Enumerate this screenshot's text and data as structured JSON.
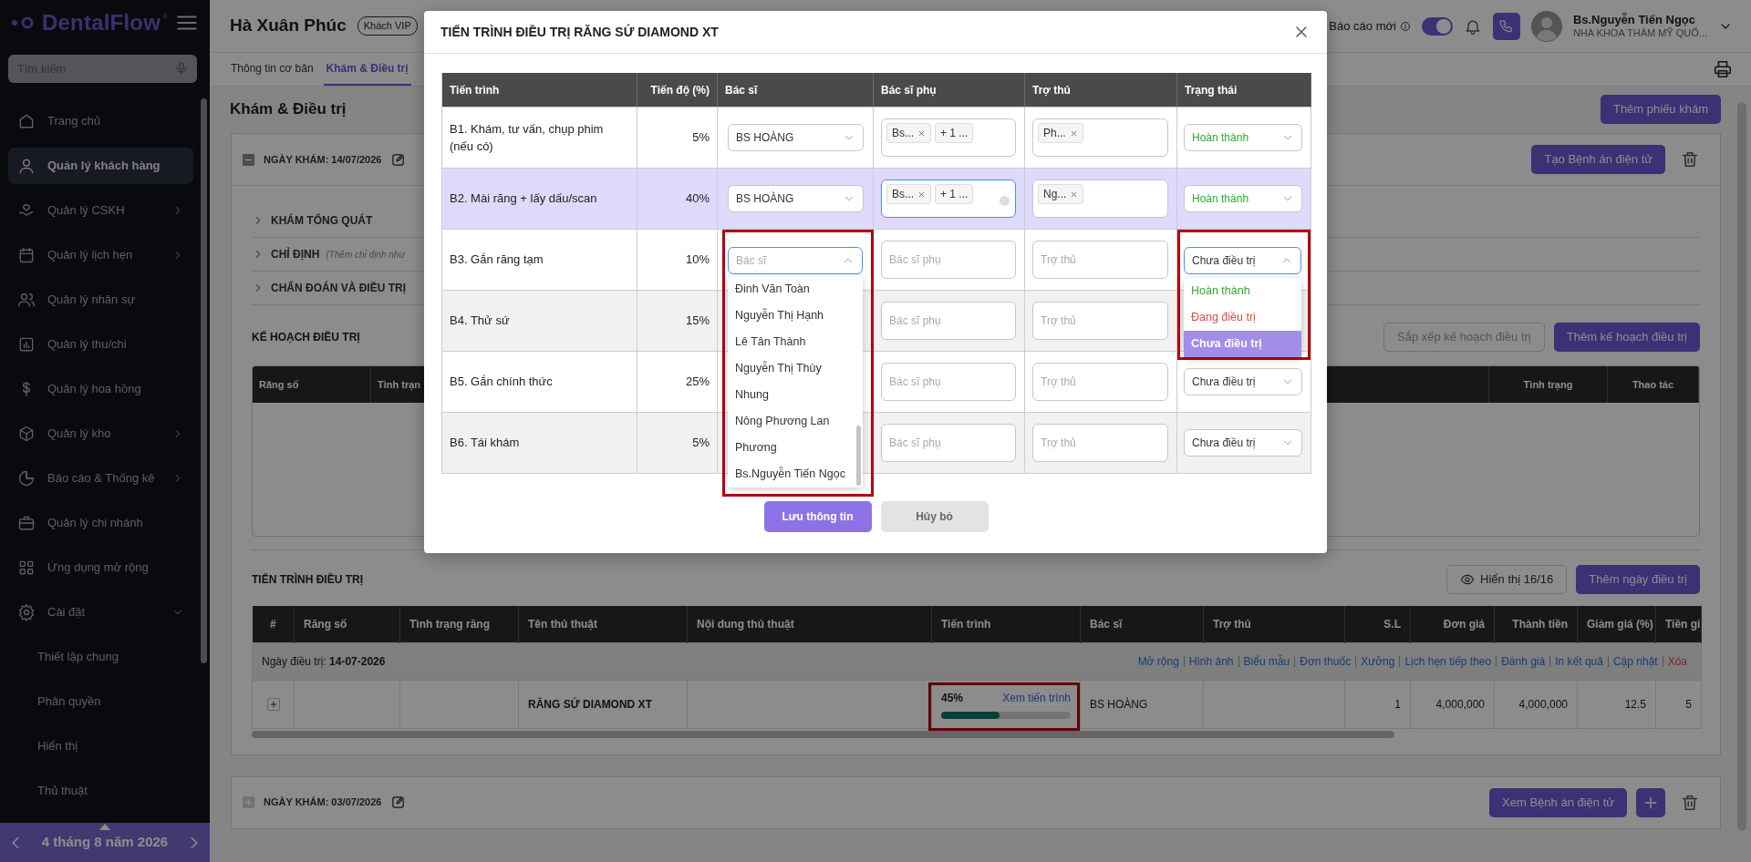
{
  "sidebar": {
    "logo": {
      "text": "DentalFlow",
      "mark": "®"
    },
    "search": {
      "placeholder": "Tìm kiếm"
    },
    "items": [
      {
        "label": "Trang chủ",
        "selected": false,
        "submenu": false
      },
      {
        "label": "Quản lý khách hàng",
        "selected": true,
        "submenu": false
      },
      {
        "label": "Quản lý CSKH",
        "selected": false,
        "submenu": true
      },
      {
        "label": "Quản lý lịch hẹn",
        "selected": false,
        "submenu": true
      },
      {
        "label": "Quản lý nhân sự",
        "selected": false,
        "submenu": false
      },
      {
        "label": "Quản lý thu/chi",
        "selected": false,
        "submenu": false
      },
      {
        "label": "Quản lý hoa hồng",
        "selected": false,
        "submenu": false
      },
      {
        "label": "Quản lý kho",
        "selected": false,
        "submenu": true
      },
      {
        "label": "Báo cáo & Thống kê",
        "selected": false,
        "submenu": true
      },
      {
        "label": "Quản lý chi nhánh",
        "selected": false,
        "submenu": false
      },
      {
        "label": "Ứng dụng mở rộng",
        "selected": false,
        "submenu": false
      },
      {
        "label": "Cài đặt",
        "selected": false,
        "submenu": true,
        "expanded": true,
        "children": [
          {
            "label": "Thiết lập chung"
          },
          {
            "label": "Phân quyền"
          },
          {
            "label": "Hiển thị"
          },
          {
            "label": "Thủ thuật"
          }
        ]
      }
    ],
    "date_bar": {
      "label": "4 tháng 8 năm 2026"
    }
  },
  "header": {
    "patient_name": "Hà Xuân Phúc",
    "badge": "Khách VIP",
    "report": {
      "label": "Báo cáo mới",
      "on": true
    },
    "user": {
      "name": "Bs.Nguyễn Tiến Ngọc",
      "clinic": "NHA KHOA THẨM MỸ QUỐ..."
    }
  },
  "tabs": [
    {
      "label": "Thông tin cơ bản",
      "selected": false
    },
    {
      "label": "Khám & Điều trị",
      "selected": true
    }
  ],
  "page": {
    "title": "Khám & Điều trị",
    "add_button": "Thêm phiếu khám"
  },
  "visits": [
    {
      "date": "NGÀY KHÁM: 14/07/2026",
      "expanded": true,
      "record_button": "Tạo Bệnh án điện tử",
      "sections": [
        {
          "title": "KHÁM TỔNG QUÁT"
        },
        {
          "title": "CHỈ ĐỊNH",
          "note": "(Thêm chỉ định như"
        },
        {
          "title": "CHẨN ĐOÁN VÀ ĐIỀU TRỊ"
        }
      ],
      "plan": {
        "title": "KẾ HOẠCH ĐIỀU TRỊ",
        "buttons": [
          {
            "label": "Sắp xếp kế hoạch điều trị",
            "kind": "outline"
          },
          {
            "label": "Thêm kế hoạch điều trị",
            "kind": "primary"
          }
        ],
        "columns": [
          "Răng số",
          "Tình trạn",
          "Tình trạng",
          "Thao tác"
        ]
      },
      "progress": {
        "title": "TIẾN TRÌNH ĐIỀU TRỊ",
        "show_button": "Hiển thị 16/16",
        "add_button": "Thêm ngày điều trị",
        "columns": [
          "#",
          "Răng số",
          "Tình trạng răng",
          "Tên thủ thuật",
          "Nội dung thủ thuật",
          "Tiến trình",
          "Bác sĩ",
          "Trợ thủ",
          "S.L",
          "Đơn giá",
          "Thành tiền",
          "Giảm giá (%)",
          "Tiền gi"
        ],
        "groups": [
          {
            "label": "Ngày điều trị: **14-07-2026**",
            "actions": [
              {
                "label": "Mở rộng",
                "kind": "link"
              },
              {
                "label": "Hình ảnh",
                "kind": "link"
              },
              {
                "label": "Biểu mẫu",
                "kind": "link"
              },
              {
                "label": "Đơn thuốc",
                "kind": "link"
              },
              {
                "label": "Xưởng",
                "kind": "link"
              },
              {
                "label": "Lịch hẹn tiếp theo",
                "kind": "link"
              },
              {
                "label": "Đánh giá",
                "kind": "link"
              },
              {
                "label": "In kết quả",
                "kind": "link"
              },
              {
                "label": "Cập nhật",
                "kind": "link"
              },
              {
                "label": "Xóa",
                "kind": "danger"
              }
            ],
            "rows": [
              {
                "procedure": "RĂNG SỨ DIAMOND XT",
                "progress": {
                  "reading": "45%",
                  "level": 0.45,
                  "link": "Xem tiến trình",
                  "highlighted": true
                },
                "doctor": "BS HOÀNG",
                "quantity": "1",
                "unit_price": "4,000,000",
                "total": "4,000,000",
                "discount": "12.5",
                "column_13": "5"
              }
            ]
          }
        ]
      }
    },
    {
      "date": "NGÀY KHÁM: 03/07/2026",
      "expanded": false,
      "record_button": "Xem Bệnh án điện tử"
    }
  ],
  "modal": {
    "title": "TIẾN TRÌNH ĐIỀU TRỊ RĂNG SỨ DIAMOND XT",
    "columns": [
      "Tiến trình",
      "Tiến độ (%)",
      "Bác sĩ",
      "Bác sĩ phụ",
      "Trợ thủ",
      "Trạng thái"
    ],
    "rows": [
      {
        "step": "B1. Khám, tư vấn, chụp phim (nếu có)",
        "percent": "5%",
        "selected": false,
        "doctor": {
          "value": "BS HOÀNG",
          "open": false,
          "highlighted": false
        },
        "assistants": {
          "tags": [
            {
              "text": "Bs...",
              "removable": true
            },
            {
              "text": "+ 1 ...",
              "removable": false
            }
          ],
          "focused": false
        },
        "helper": {
          "tags": [
            {
              "text": "Ph...",
              "removable": true
            }
          ],
          "focused": false
        },
        "status": {
          "value": "Hoàn thành",
          "color": "#2eaa2e",
          "open": false,
          "highlighted": false
        }
      },
      {
        "step": "B2. Mài răng + lấy dấu/scan",
        "percent": "40%",
        "selected": true,
        "doctor": {
          "value": "BS HOÀNG",
          "open": false,
          "highlighted": false
        },
        "assistants": {
          "tags": [
            {
              "text": "Bs...",
              "removable": true
            },
            {
              "text": "+ 1 ...",
              "removable": false
            }
          ],
          "focused": true
        },
        "helper": {
          "tags": [
            {
              "text": "Ng...",
              "removable": true
            }
          ],
          "focused": false
        },
        "status": {
          "value": "Hoàn thành",
          "color": "#2eaa2e",
          "open": false,
          "highlighted": false
        }
      },
      {
        "step": "B3. Gắn răng tạm",
        "percent": "10%",
        "selected": false,
        "doctor": {
          "placeholder": "Bác sĩ",
          "open": true,
          "highlighted": true,
          "options": [
            "Đinh Văn Toàn",
            "Nguyễn Thị Hạnh",
            "Lê Tân Thành",
            "Nguyễn Thị Thùy",
            "Nhung",
            "Nông Phương Lan",
            "Phương",
            "Bs.Nguyễn Tiến Ngọc"
          ]
        },
        "assistants": {
          "placeholder": "Bác sĩ phụ",
          "focused": false
        },
        "helper": {
          "placeholder": "Trợ thủ",
          "focused": false
        },
        "status": {
          "value": "Chưa điều trị",
          "color": "#333333",
          "open": true,
          "highlighted": true,
          "options": [
            {
              "label": "Hoàn thành",
              "color": "#2eaa2e",
              "selected": false
            },
            {
              "label": "Đang điều trị",
              "color": "#e44b4b",
              "selected": false
            },
            {
              "label": "Chưa điều trị",
              "selected": true
            }
          ]
        }
      },
      {
        "step": "B4. Thử sứ",
        "percent": "15%",
        "selected": false,
        "assistants": {
          "placeholder": "Bác sĩ phụ",
          "focused": false
        },
        "helper": {
          "placeholder": "Trợ thủ",
          "focused": false
        }
      },
      {
        "step": "B5. Gắn chính thức",
        "percent": "25%",
        "selected": false,
        "assistants": {
          "placeholder": "Bác sĩ phụ",
          "focused": false
        },
        "helper": {
          "placeholder": "Trợ thủ",
          "focused": false
        },
        "status": {
          "value": "Chưa điều trị",
          "color": "#333333",
          "open": false,
          "highlighted": false
        }
      },
      {
        "step": "B6. Tái khám",
        "percent": "5%",
        "selected": false,
        "assistants": {
          "placeholder": "Bác sĩ phụ",
          "focused": false
        },
        "helper": {
          "placeholder": "Trợ thủ",
          "focused": false
        },
        "status": {
          "value": "Chưa điều trị",
          "color": "#333333",
          "open": false,
          "highlighted": false
        }
      }
    ],
    "buttons": [
      {
        "label": "Lưu thông tin",
        "kind": "primary"
      },
      {
        "label": "Hủy bỏ",
        "kind": "secondary"
      }
    ]
  }
}
